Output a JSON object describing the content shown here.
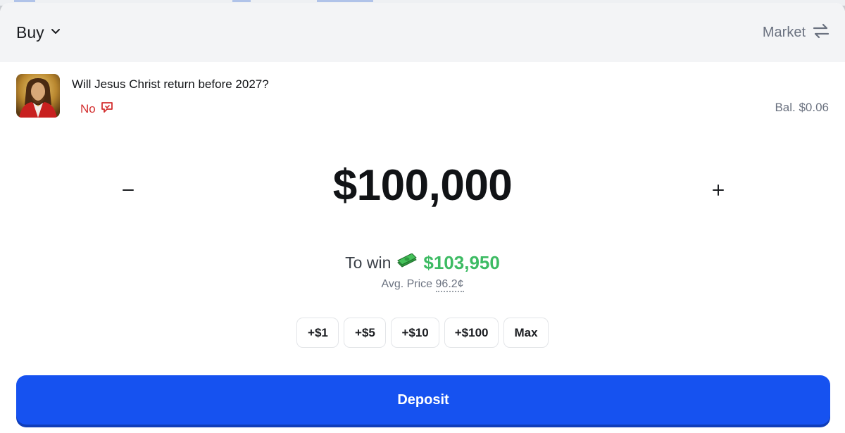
{
  "header": {
    "side_label": "Buy",
    "order_type_label": "Market"
  },
  "market": {
    "question": "Will Jesus Christ return before 2027?",
    "outcome": "No",
    "balance": "Bal. $0.06"
  },
  "order": {
    "amount": "$100,000",
    "to_win_label": "To win",
    "to_win_value": "$103,950",
    "avg_price_label": "Avg. Price",
    "avg_price_value": "96.2¢"
  },
  "quick_amounts": [
    "+$1",
    "+$5",
    "+$10",
    "+$100",
    "Max"
  ],
  "actions": {
    "deposit_label": "Deposit"
  },
  "colors": {
    "primary": "#1652f0",
    "win_green": "#3dbb63",
    "no_red": "#d32f2f"
  },
  "icons": {
    "side_dropdown": "chevron-down-icon",
    "order_type": "swap-arrows-icon",
    "outcome": "comment-icon",
    "decrement": "minus-icon",
    "increment": "plus-icon",
    "money": "money-icon"
  }
}
